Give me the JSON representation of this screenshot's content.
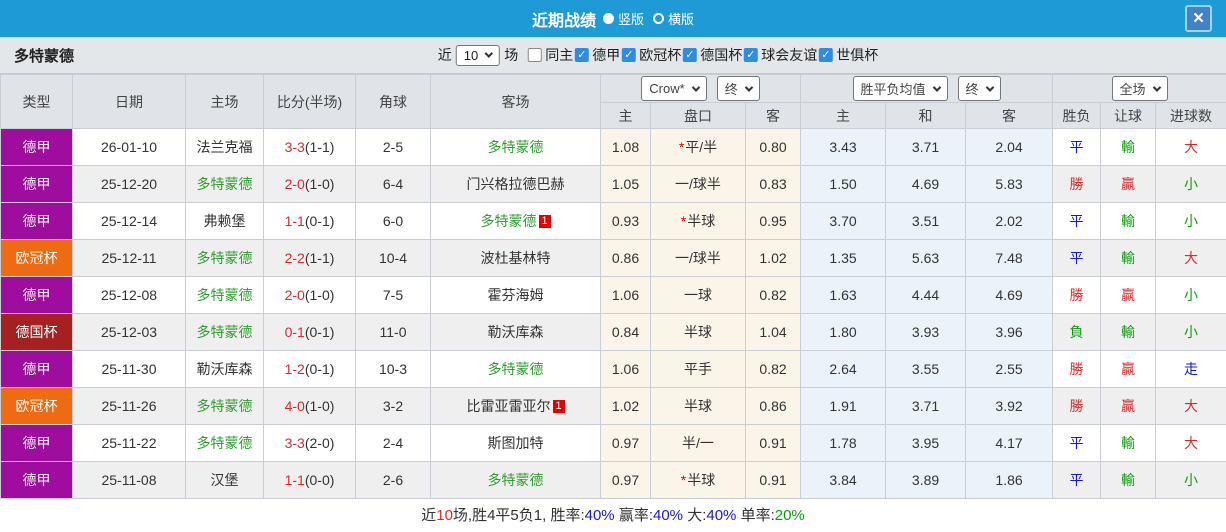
{
  "titlebar": {
    "title": "近期战绩",
    "close_icon": "×",
    "layout_options": [
      {
        "label": "竖版",
        "selected": true
      },
      {
        "label": "横版",
        "selected": false
      }
    ]
  },
  "filterbar": {
    "team": "多特蒙德",
    "near_label": "近",
    "count_value": "10",
    "games_label": "场",
    "checkboxes": [
      {
        "label": "同主",
        "checked": false
      },
      {
        "label": "德甲",
        "checked": true
      },
      {
        "label": "欧冠杯",
        "checked": true
      },
      {
        "label": "德国杯",
        "checked": true
      },
      {
        "label": "球会友谊",
        "checked": true
      },
      {
        "label": "世俱杯",
        "checked": true
      }
    ]
  },
  "table": {
    "left_headers": [
      "类型",
      "日期",
      "主场",
      "比分(半场)",
      "角球",
      "客场"
    ],
    "dropdowns": {
      "company": "Crow*",
      "company_time": "终",
      "odds": "胜平负均值",
      "odds_time": "终",
      "scope": "全场"
    },
    "sub_headers": [
      "主",
      "盘口",
      "客",
      "主",
      "和",
      "客",
      "胜负",
      "让球",
      "进球数"
    ],
    "league_colors": {
      "德甲": "#9e0d9e",
      "欧冠杯": "#ef6b12",
      "德国杯": "#a52020"
    },
    "rows": [
      {
        "league": "德甲",
        "league_color": "#9e0d9e",
        "date": "26-01-10",
        "home": {
          "name": "法兰克福",
          "green": false,
          "badge": ""
        },
        "score": "3-3",
        "half": "(1-1)",
        "corner": "2-5",
        "away": {
          "name": "多特蒙德",
          "green": true,
          "badge": ""
        },
        "crow_home": "1.08",
        "handicap": {
          "star": true,
          "text": "平/半"
        },
        "crow_away": "0.80",
        "avg_home": "3.43",
        "avg_draw": "3.71",
        "avg_away": "2.04",
        "res_wdl": {
          "text": "平",
          "cls": "c-blue"
        },
        "res_handicap": {
          "text": "輸",
          "cls": "c-green"
        },
        "res_goals": {
          "text": "大",
          "cls": "c-red"
        }
      },
      {
        "league": "德甲",
        "league_color": "#9e0d9e",
        "date": "25-12-20",
        "home": {
          "name": "多特蒙德",
          "green": true,
          "badge": ""
        },
        "score": "2-0",
        "half": "(1-0)",
        "corner": "6-4",
        "away": {
          "name": "门兴格拉德巴赫",
          "green": false,
          "badge": ""
        },
        "crow_home": "1.05",
        "handicap": {
          "star": false,
          "text": "一/球半"
        },
        "crow_away": "0.83",
        "avg_home": "1.50",
        "avg_draw": "4.69",
        "avg_away": "5.83",
        "res_wdl": {
          "text": "勝",
          "cls": "c-red"
        },
        "res_handicap": {
          "text": "贏",
          "cls": "c-red"
        },
        "res_goals": {
          "text": "小",
          "cls": "c-green"
        }
      },
      {
        "league": "德甲",
        "league_color": "#9e0d9e",
        "date": "25-12-14",
        "home": {
          "name": "弗赖堡",
          "green": false,
          "badge": ""
        },
        "score": "1-1",
        "half": "(0-1)",
        "corner": "6-0",
        "away": {
          "name": "多特蒙德",
          "green": true,
          "badge": "1"
        },
        "crow_home": "0.93",
        "handicap": {
          "star": true,
          "text": "半球"
        },
        "crow_away": "0.95",
        "avg_home": "3.70",
        "avg_draw": "3.51",
        "avg_away": "2.02",
        "res_wdl": {
          "text": "平",
          "cls": "c-blue"
        },
        "res_handicap": {
          "text": "輸",
          "cls": "c-green"
        },
        "res_goals": {
          "text": "小",
          "cls": "c-green"
        }
      },
      {
        "league": "欧冠杯",
        "league_color": "#ef6b12",
        "date": "25-12-11",
        "home": {
          "name": "多特蒙德",
          "green": true,
          "badge": ""
        },
        "score": "2-2",
        "half": "(1-1)",
        "corner": "10-4",
        "away": {
          "name": "波杜基林特",
          "green": false,
          "badge": ""
        },
        "crow_home": "0.86",
        "handicap": {
          "star": false,
          "text": "一/球半"
        },
        "crow_away": "1.02",
        "avg_home": "1.35",
        "avg_draw": "5.63",
        "avg_away": "7.48",
        "res_wdl": {
          "text": "平",
          "cls": "c-blue"
        },
        "res_handicap": {
          "text": "輸",
          "cls": "c-green"
        },
        "res_goals": {
          "text": "大",
          "cls": "c-red"
        }
      },
      {
        "league": "德甲",
        "league_color": "#9e0d9e",
        "date": "25-12-08",
        "home": {
          "name": "多特蒙德",
          "green": true,
          "badge": ""
        },
        "score": "2-0",
        "half": "(1-0)",
        "corner": "7-5",
        "away": {
          "name": "霍芬海姆",
          "green": false,
          "badge": ""
        },
        "crow_home": "1.06",
        "handicap": {
          "star": false,
          "text": "一球"
        },
        "crow_away": "0.82",
        "avg_home": "1.63",
        "avg_draw": "4.44",
        "avg_away": "4.69",
        "res_wdl": {
          "text": "勝",
          "cls": "c-red"
        },
        "res_handicap": {
          "text": "贏",
          "cls": "c-red"
        },
        "res_goals": {
          "text": "小",
          "cls": "c-green"
        }
      },
      {
        "league": "德国杯",
        "league_color": "#a52020",
        "date": "25-12-03",
        "home": {
          "name": "多特蒙德",
          "green": true,
          "badge": ""
        },
        "score": "0-1",
        "half": "(0-1)",
        "corner": "11-0",
        "away": {
          "name": "勒沃库森",
          "green": false,
          "badge": ""
        },
        "crow_home": "0.84",
        "handicap": {
          "star": false,
          "text": "半球"
        },
        "crow_away": "1.04",
        "avg_home": "1.80",
        "avg_draw": "3.93",
        "avg_away": "3.96",
        "res_wdl": {
          "text": "負",
          "cls": "c-green"
        },
        "res_handicap": {
          "text": "輸",
          "cls": "c-green"
        },
        "res_goals": {
          "text": "小",
          "cls": "c-green"
        }
      },
      {
        "league": "德甲",
        "league_color": "#9e0d9e",
        "date": "25-11-30",
        "home": {
          "name": "勒沃库森",
          "green": false,
          "badge": ""
        },
        "score": "1-2",
        "half": "(0-1)",
        "corner": "10-3",
        "away": {
          "name": "多特蒙德",
          "green": true,
          "badge": ""
        },
        "crow_home": "1.06",
        "handicap": {
          "star": false,
          "text": "平手"
        },
        "crow_away": "0.82",
        "avg_home": "2.64",
        "avg_draw": "3.55",
        "avg_away": "2.55",
        "res_wdl": {
          "text": "勝",
          "cls": "c-red"
        },
        "res_handicap": {
          "text": "贏",
          "cls": "c-red"
        },
        "res_goals": {
          "text": "走",
          "cls": "c-blue"
        }
      },
      {
        "league": "欧冠杯",
        "league_color": "#ef6b12",
        "date": "25-11-26",
        "home": {
          "name": "多特蒙德",
          "green": true,
          "badge": ""
        },
        "score": "4-0",
        "half": "(1-0)",
        "corner": "3-2",
        "away": {
          "name": "比雷亚雷亚尔",
          "green": false,
          "badge": "1"
        },
        "crow_home": "1.02",
        "handicap": {
          "star": false,
          "text": "半球"
        },
        "crow_away": "0.86",
        "avg_home": "1.91",
        "avg_draw": "3.71",
        "avg_away": "3.92",
        "res_wdl": {
          "text": "勝",
          "cls": "c-red"
        },
        "res_handicap": {
          "text": "贏",
          "cls": "c-red"
        },
        "res_goals": {
          "text": "大",
          "cls": "c-red"
        }
      },
      {
        "league": "德甲",
        "league_color": "#9e0d9e",
        "date": "25-11-22",
        "home": {
          "name": "多特蒙德",
          "green": true,
          "badge": ""
        },
        "score": "3-3",
        "half": "(2-0)",
        "corner": "2-4",
        "away": {
          "name": "斯图加特",
          "green": false,
          "badge": ""
        },
        "crow_home": "0.97",
        "handicap": {
          "star": false,
          "text": "半/一"
        },
        "crow_away": "0.91",
        "avg_home": "1.78",
        "avg_draw": "3.95",
        "avg_away": "4.17",
        "res_wdl": {
          "text": "平",
          "cls": "c-blue"
        },
        "res_handicap": {
          "text": "輸",
          "cls": "c-green"
        },
        "res_goals": {
          "text": "大",
          "cls": "c-red"
        }
      },
      {
        "league": "德甲",
        "league_color": "#9e0d9e",
        "date": "25-11-08",
        "home": {
          "name": "汉堡",
          "green": false,
          "badge": ""
        },
        "score": "1-1",
        "half": "(0-0)",
        "corner": "2-6",
        "away": {
          "name": "多特蒙德",
          "green": true,
          "badge": ""
        },
        "crow_home": "0.97",
        "handicap": {
          "star": true,
          "text": "半球"
        },
        "crow_away": "0.91",
        "avg_home": "3.84",
        "avg_draw": "3.89",
        "avg_away": "1.86",
        "res_wdl": {
          "text": "平",
          "cls": "c-blue"
        },
        "res_handicap": {
          "text": "輸",
          "cls": "c-green"
        },
        "res_goals": {
          "text": "小",
          "cls": "c-green"
        }
      }
    ]
  },
  "summary": {
    "segments": [
      {
        "text": "近",
        "cls": ""
      },
      {
        "text": "10",
        "cls": "c-red"
      },
      {
        "text": "场,胜4平5负1, 胜率:",
        "cls": ""
      },
      {
        "text": "40%",
        "cls": "c-blue"
      },
      {
        "text": " 赢率:",
        "cls": ""
      },
      {
        "text": "40%",
        "cls": "c-blue"
      },
      {
        "text": " 大:",
        "cls": ""
      },
      {
        "text": "40%",
        "cls": "c-blue"
      },
      {
        "text": " 单率:",
        "cls": ""
      },
      {
        "text": "20%",
        "cls": "c-green"
      }
    ]
  },
  "colors": {
    "titlebar_bg": "#1e9ad6",
    "checkbox_blue": "#2e8ce4",
    "team_green": "#2e9e2e",
    "result_red": "#d92b2b",
    "result_blue": "#1919cd",
    "result_green": "#0b9c0b",
    "crow_col_bg": "#fbf5e9",
    "avg_col_bg": "#eaf3fa"
  }
}
